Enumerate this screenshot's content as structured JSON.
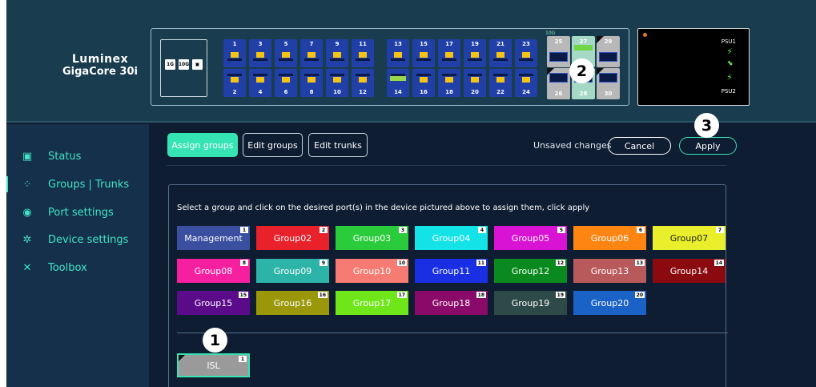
{
  "brand": {
    "line1": "Luminex",
    "line2": "GigaCore 30i"
  },
  "speed_icons": [
    "1G",
    "10G",
    "▣"
  ],
  "ports": {
    "rj45_top": [
      "1",
      "3",
      "5",
      "7",
      "9",
      "11",
      "13",
      "15",
      "17",
      "19",
      "21",
      "23"
    ],
    "rj45_bottom": [
      "2",
      "4",
      "6",
      "8",
      "10",
      "12",
      "14",
      "16",
      "18",
      "20",
      "22",
      "24"
    ],
    "sfp_label": "10G",
    "sfp_top": [
      "25",
      "27",
      "29"
    ],
    "sfp_bottom": [
      "26",
      "28",
      "30"
    ]
  },
  "psu": {
    "psu1": "PSU1",
    "psu2": "PSU2",
    "psu_icon": "⚡",
    "arrow": "⬊"
  },
  "callouts": [
    "1",
    "2",
    "3"
  ],
  "sidebar": {
    "items": [
      {
        "icon": "▣",
        "label": "Status"
      },
      {
        "icon": "⁘",
        "label": "Groups | Trunks"
      },
      {
        "icon": "◉",
        "label": "Port settings"
      },
      {
        "icon": "✲",
        "label": "Device settings"
      },
      {
        "icon": "✕",
        "label": "Toolbox"
      }
    ]
  },
  "toolbar": {
    "tabs": [
      "Assign groups",
      "Edit groups",
      "Edit trunks"
    ],
    "unsaved": "Unsaved changes",
    "cancel": "Cancel",
    "apply": "Apply"
  },
  "instruction": "Select a group and click on the desired port(s) in the device pictured above to assign them, click apply",
  "groups": [
    {
      "name": "Management",
      "num": "1",
      "color": "#3a4fa0"
    },
    {
      "name": "Group02",
      "num": "2",
      "color": "#e8212b"
    },
    {
      "name": "Group03",
      "num": "3",
      "color": "#2bcc3c"
    },
    {
      "name": "Group04",
      "num": "4",
      "color": "#13e2e6"
    },
    {
      "name": "Group05",
      "num": "5",
      "color": "#d813d4"
    },
    {
      "name": "Group06",
      "num": "6",
      "color": "#ff8513"
    },
    {
      "name": "Group07",
      "num": "7",
      "color": "#e9ef2a"
    },
    {
      "name": "Group08",
      "num": "8",
      "color": "#f51f9f"
    },
    {
      "name": "Group09",
      "num": "9",
      "color": "#2db4a8"
    },
    {
      "name": "Group10",
      "num": "10",
      "color": "#f67b72"
    },
    {
      "name": "Group11",
      "num": "11",
      "color": "#1a2fe4"
    },
    {
      "name": "Group12",
      "num": "12",
      "color": "#0a8a1e"
    },
    {
      "name": "Group13",
      "num": "13",
      "color": "#b85a5c"
    },
    {
      "name": "Group14",
      "num": "14",
      "color": "#8a0a10"
    },
    {
      "name": "Group15",
      "num": "15",
      "color": "#5b0a8a"
    },
    {
      "name": "Group16",
      "num": "16",
      "color": "#9a980a"
    },
    {
      "name": "Group17",
      "num": "17",
      "color": "#6ee61a"
    },
    {
      "name": "Group18",
      "num": "18",
      "color": "#8a0a6a"
    },
    {
      "name": "Group19",
      "num": "19",
      "color": "#2e4a48"
    },
    {
      "name": "Group20",
      "num": "20",
      "color": "#1a62c6"
    }
  ],
  "isl": {
    "name": "ISL",
    "num": "1",
    "color": "#9a9a9a"
  }
}
